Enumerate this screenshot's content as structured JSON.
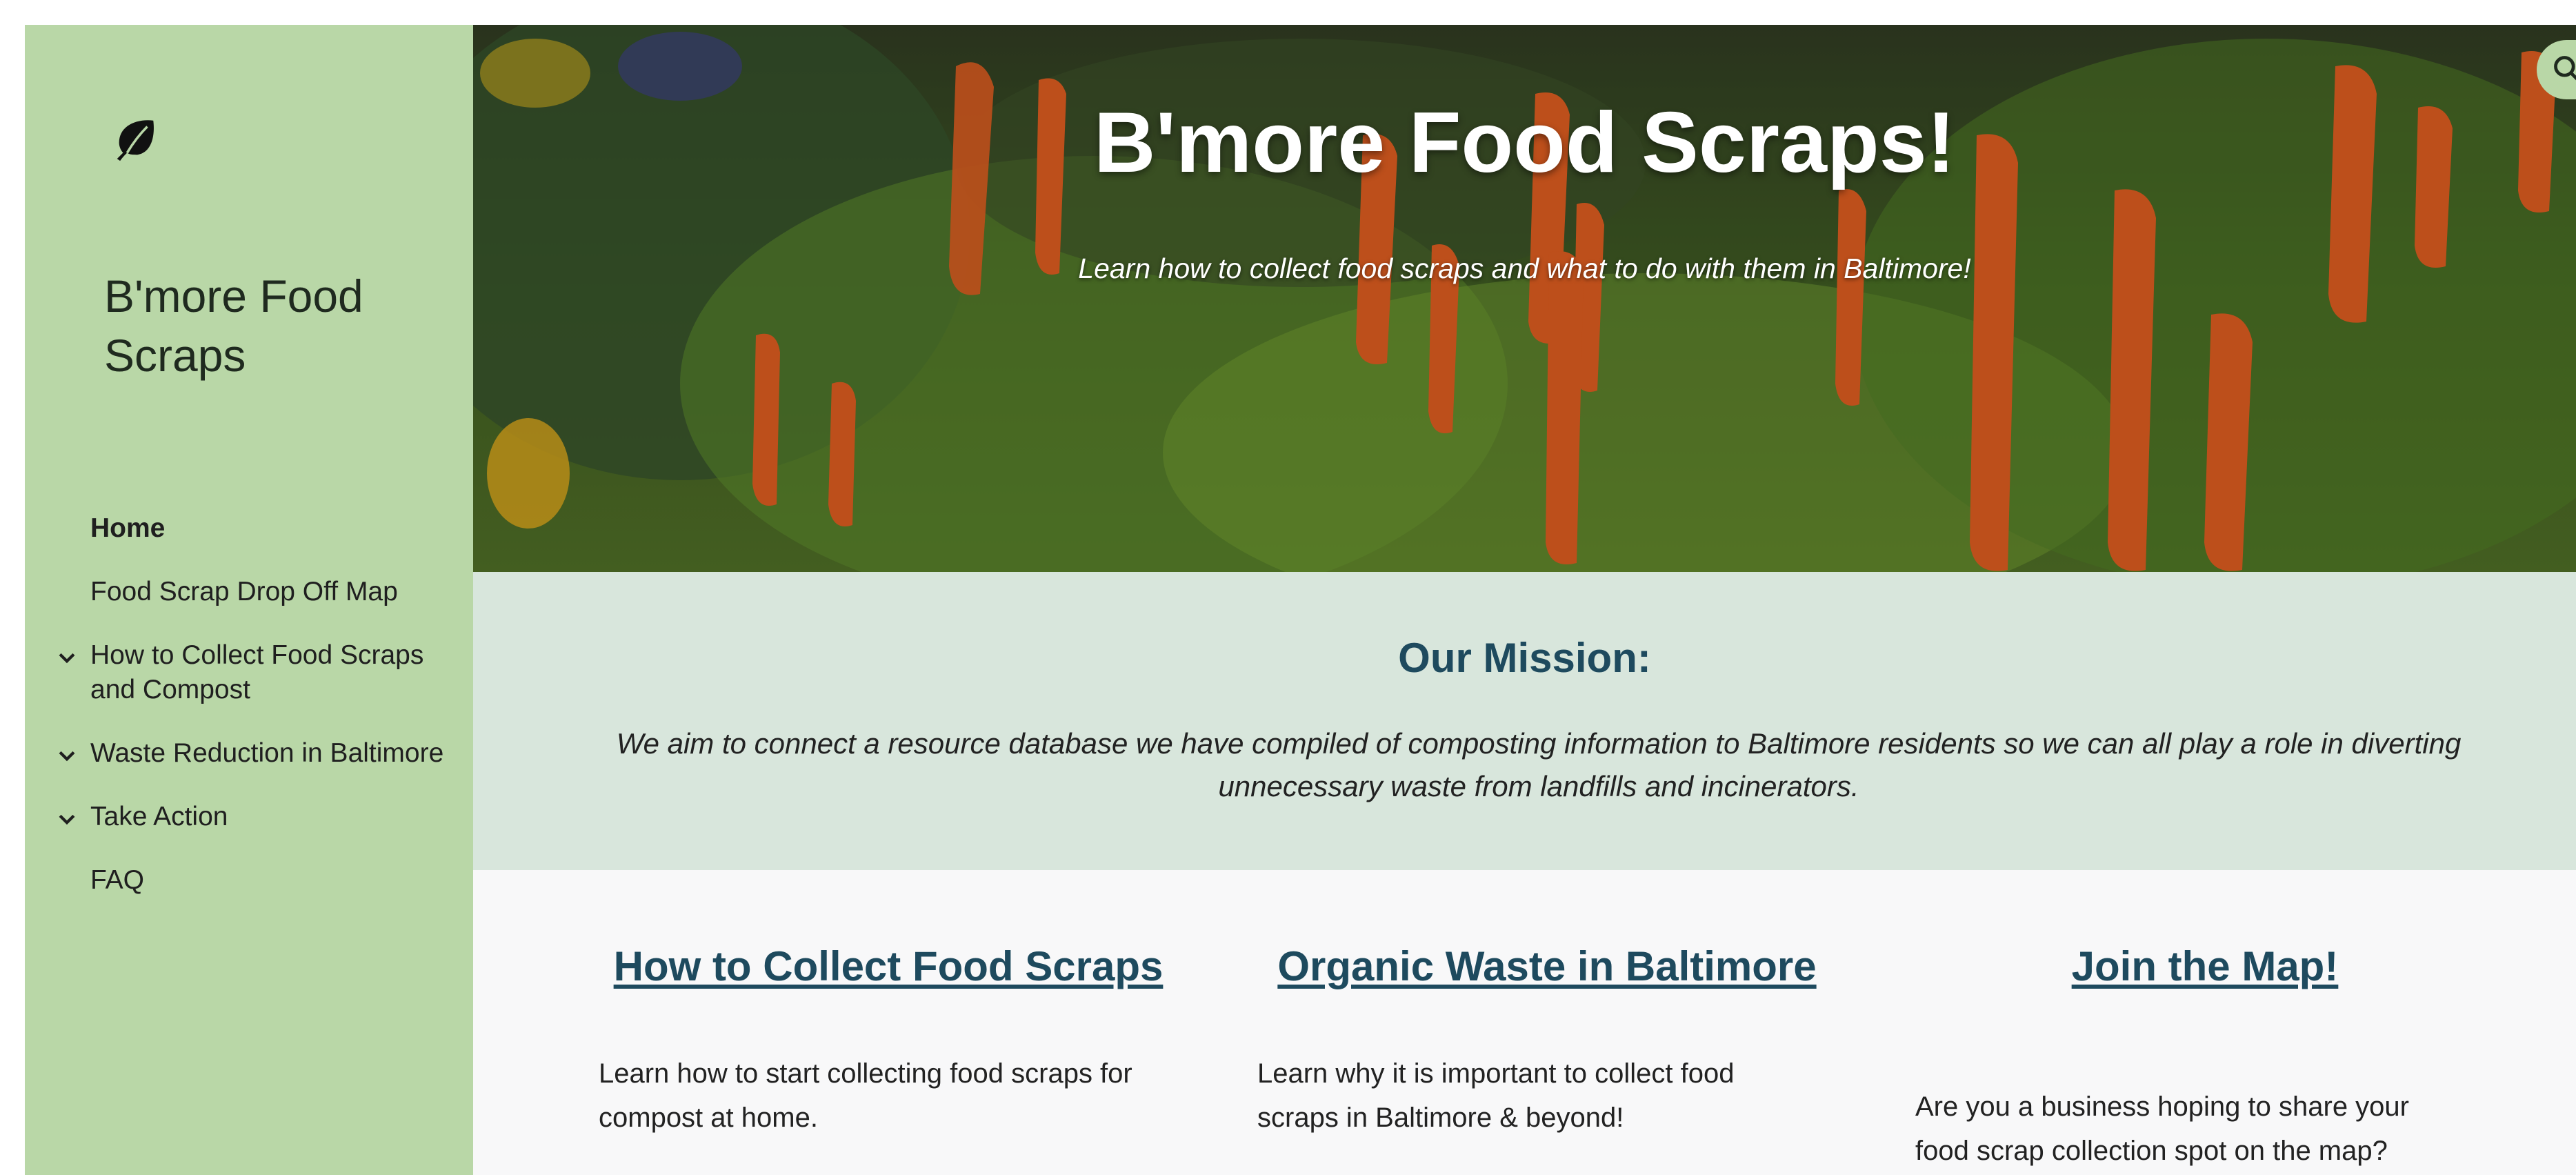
{
  "sidebar": {
    "logo_icon": "leaf-icon",
    "site_title": "B'more Food Scraps",
    "nav": [
      {
        "label": "Home",
        "active": true,
        "expandable": false
      },
      {
        "label": "Food Scrap Drop Off Map",
        "active": false,
        "expandable": false
      },
      {
        "label": "How to Collect Food Scraps and Compost",
        "active": false,
        "expandable": true
      },
      {
        "label": "Waste Reduction in Baltimore",
        "active": false,
        "expandable": true
      },
      {
        "label": "Take Action",
        "active": false,
        "expandable": true
      },
      {
        "label": "FAQ",
        "active": false,
        "expandable": false
      }
    ]
  },
  "hero": {
    "title": "B'more Food Scraps!",
    "subtitle": "Learn how to collect food scraps and what to do with them in Baltimore!",
    "search_icon": "search-icon"
  },
  "mission": {
    "title": "Our Mission:",
    "text": "We aim to connect a resource database we have compiled of composting information to Baltimore residents so we can all play a role in diverting unnecessary waste from landfills and incinerators."
  },
  "cards": [
    {
      "title": "How to Collect Food Scraps",
      "text": "Learn how to start collecting food scraps for compost at home."
    },
    {
      "title": "Organic Waste in Baltimore",
      "text": "Learn why it is important to collect food scraps in Baltimore & beyond!"
    },
    {
      "title": "Join the Map!",
      "text": "Are you a business hoping to share your food scrap collection spot on the map?"
    }
  ],
  "colors": {
    "sidebar_bg": "#b9d7a7",
    "mission_bg": "#d8e6dc",
    "heading": "#1e4a5e",
    "cards_bg": "#f8f8f9"
  }
}
